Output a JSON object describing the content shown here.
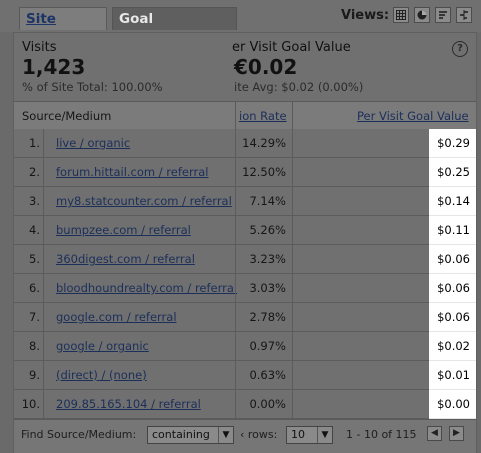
{
  "tabs": [
    {
      "label": "Site Usage",
      "active": false
    },
    {
      "label": "Goal Conversion",
      "active": true
    }
  ],
  "views": {
    "label": "Views:",
    "buttons": [
      "table-view-icon",
      "pie-view-icon",
      "bar-view-icon",
      "comparison-view-icon"
    ]
  },
  "summary": {
    "visits_label": "Visits",
    "visits_value": "1,423",
    "visits_sub": "% of Site Total: 100.00%",
    "goal_label": "er Visit Goal Value",
    "goal_value": "€0.02",
    "goal_sub": "ite Avg: $0.02 (0.00%)",
    "help": "?"
  },
  "table": {
    "headers": {
      "source": "Source/Medium",
      "rate": "ion Rate",
      "value": "Per Visit Goal Value"
    },
    "rows": [
      {
        "n": "1.",
        "source": "live / organic",
        "rate": "14.29%",
        "value": "$0.29"
      },
      {
        "n": "2.",
        "source": "forum.hittail.com / referral",
        "rate": "12.50%",
        "value": "$0.25"
      },
      {
        "n": "3.",
        "source": "my8.statcounter.com / referral",
        "rate": "7.14%",
        "value": "$0.14"
      },
      {
        "n": "4.",
        "source": "bumpzee.com / referral",
        "rate": "5.26%",
        "value": "$0.11"
      },
      {
        "n": "5.",
        "source": "360digest.com / referral",
        "rate": "3.23%",
        "value": "$0.06"
      },
      {
        "n": "6.",
        "source": "bloodhoundrealty.com / referral",
        "rate": "3.03%",
        "value": "$0.06"
      },
      {
        "n": "7.",
        "source": "google.com / referral",
        "rate": "2.78%",
        "value": "$0.06"
      },
      {
        "n": "8.",
        "source": "google / organic",
        "rate": "0.97%",
        "value": "$0.02"
      },
      {
        "n": "9.",
        "source": "(direct) / (none)",
        "rate": "0.63%",
        "value": "$0.01"
      },
      {
        "n": "10.",
        "source": "209.85.165.104 / referral",
        "rate": "0.00%",
        "value": "$0.00"
      }
    ]
  },
  "footer": {
    "find_label": "Find Source/Medium:",
    "filter_mode": "containing",
    "rows_label": "‹ rows:",
    "rows_value": "10",
    "range": "1 - 10 of 115"
  }
}
